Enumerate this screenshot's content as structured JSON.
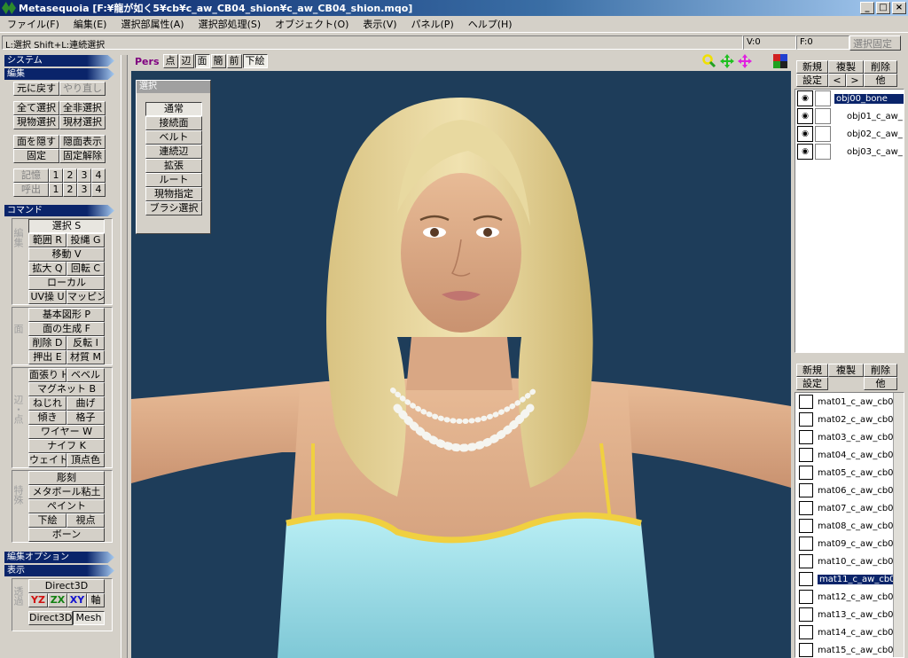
{
  "title_bar": {
    "title": "Metasequoia [F:¥龍が如く5¥cb¥c_aw_CB04_shion¥c_aw_CB04_shion.mqo]",
    "minimize": "_",
    "maximize": "□",
    "close": "×"
  },
  "menu": [
    "ファイル(F)",
    "編集(E)",
    "選択部属性(A)",
    "選択部処理(S)",
    "オブジェクト(O)",
    "表示(V)",
    "パネル(P)",
    "ヘルプ(H)"
  ],
  "status": {
    "hint": "L:選択  Shift+L:連続選択",
    "vertices": "V:0",
    "faces": "F:0",
    "lock_button": "選択固定"
  },
  "left": {
    "system": "システム",
    "edit": "編集",
    "undo": "元に戻す",
    "redo": "やり直し",
    "select_all": "全て選択",
    "deselect_all": "全非選択",
    "cur_obj_select": "現物選択",
    "cur_mat_select": "現材選択",
    "hide_faces": "面を隠す",
    "show_hidden": "隠面表示",
    "fix": "固定",
    "unfix": "固定解除",
    "memory": "記憶",
    "recall": "呼出",
    "slots": [
      "1",
      "2",
      "3",
      "4"
    ],
    "command": "コマンド",
    "group_edit": "編集",
    "group_face": "面",
    "group_edge": "辺・点",
    "group_special": "特殊",
    "select": "選択 S",
    "range": "範囲 R",
    "lasso": "投縄 G",
    "move": "移動 V",
    "scale": "拡大 Q",
    "rotate": "回転 C",
    "local": "ローカル",
    "uv": "UV操 U",
    "mapping": "マッピング",
    "primitive": "基本図形 P",
    "face_gen": "面の生成 F",
    "delete": "削除 D",
    "flip": "反転 I",
    "extrude": "押出 E",
    "material": "材質 M",
    "face_stretch": "面張り H",
    "bevel": "ベベル",
    "magnet": "マグネット B",
    "twist": "ねじれ",
    "bend": "曲げ",
    "tilt": "傾き",
    "lattice": "格子",
    "wire": "ワイヤー W",
    "knife": "ナイフ K",
    "weight": "ウェイト",
    "vertex_color": "頂点色",
    "sculpt": "彫刻",
    "metaball": "メタボール粘土",
    "paint": "ペイント",
    "underlay": "下絵",
    "viewpoint": "視点",
    "bone": "ボーン",
    "edit_option": "編集オプション",
    "display": "表示",
    "direct3d": "Direct3D",
    "axis_yz": "YZ",
    "axis_zx": "ZX",
    "axis_xy": "XY",
    "axis": "軸",
    "group_display": "透過",
    "direct3d_2": "Direct3D",
    "mesh": "Mesh"
  },
  "viewport": {
    "mode": "Pers",
    "point": "点",
    "edge": "辺",
    "face": "面",
    "simple": "簡",
    "front": "前",
    "underlay": "下絵",
    "zoom_icon_color": "#f0e000",
    "move_icon_color": "#20c020",
    "rotate_icon_color": "#e020e0"
  },
  "select_palette": {
    "title": "選択",
    "items": [
      "通常",
      "接続面",
      "ベルト",
      "連続辺",
      "拡張",
      "ルート",
      "現物指定",
      "ブラシ選択"
    ]
  },
  "objects_panel": {
    "new": "新規",
    "copy": "複製",
    "delete": "削除",
    "settings": "設定",
    "prev": "<",
    "next": ">",
    "other": "他",
    "items": [
      "obj00_bone",
      "obj01_c_aw_",
      "obj02_c_aw_",
      "obj03_c_aw_"
    ]
  },
  "materials_panel": {
    "new": "新規",
    "copy": "複製",
    "delete": "削除",
    "settings": "設定",
    "other": "他",
    "items": [
      "mat01_c_aw_cb0",
      "mat02_c_aw_cb0",
      "mat03_c_aw_cb0",
      "mat04_c_aw_cb0",
      "mat05_c_aw_cb0",
      "mat06_c_aw_cb0",
      "mat07_c_aw_cb0",
      "mat08_c_aw_cb0",
      "mat09_c_aw_cb0",
      "mat10_c_aw_cb0",
      "mat11_c_aw_cb0",
      "mat12_c_aw_cb0",
      "mat13_c_aw_cb0",
      "mat14_c_aw_cb0",
      "mat15_c_aw_cb0"
    ]
  },
  "colors": {
    "viewport_bg": "#1e3d5a",
    "selection": "#0a246a",
    "hair": "#e8d9a0",
    "skin": "#e2b38f",
    "dress": "#a8e4ec",
    "trim": "#f0d040"
  }
}
